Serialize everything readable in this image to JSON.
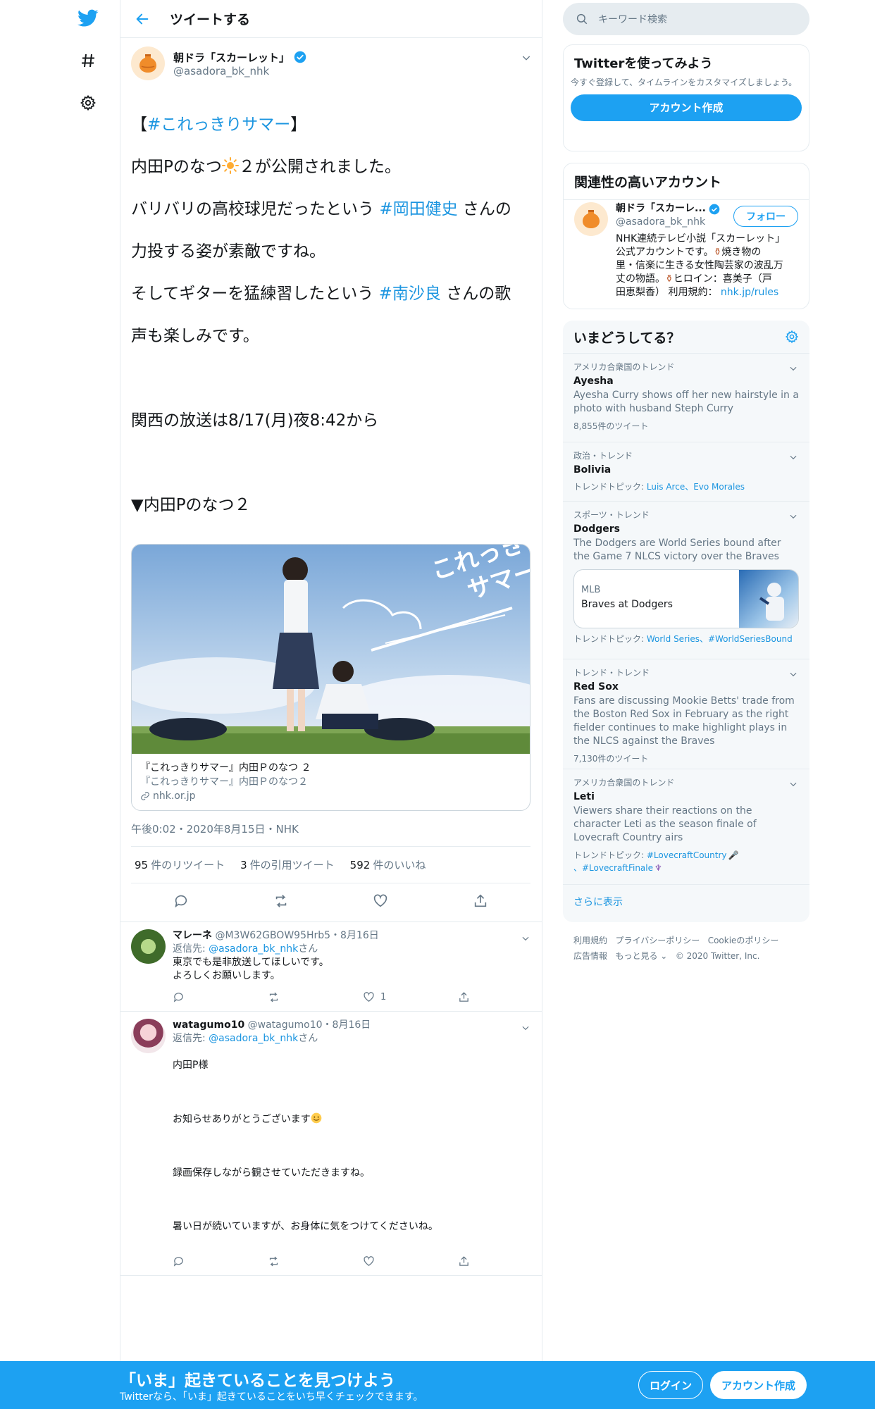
{
  "nav": {
    "icons": [
      "twitter-bird-icon",
      "hashtag-icon",
      "gear-icon"
    ]
  },
  "header": {
    "title": "ツイートする"
  },
  "tweet": {
    "author_name": "朝ドラ「スカーレット」",
    "author_handle": "@asadora_bk_nhk",
    "line1_pre": "【",
    "line1_tag": "#これっきりサマー",
    "line1_post": "】",
    "line2_pre": "内田Pのなつ",
    "line2_post": "２が公開されました。",
    "line3_pre": "バリバリの高校球児だったという ",
    "line3_tag": "#岡田健史",
    "line3_post": " さんの",
    "line4": "力投する姿が素敵ですね。",
    "line5_pre": "そしてギターを猛練習したという ",
    "line5_tag": "#南沙良",
    "line5_post": " さんの歌",
    "line6": "声も楽しみです。",
    "line7": "関西の放送は8/17(月)夜8:42から",
    "line8": "▼内田Pのなつ２",
    "card": {
      "image_text": "これっきり サマー",
      "title": "『これっきりサマー』内田Ｐのなつ ２",
      "description": "『これっきりサマー』内田Ｐのなつ２",
      "domain": "nhk.or.jp"
    },
    "meta": "午後0:02・2020年8月15日・NHK",
    "retweets_count": "95",
    "retweets_label": "件のリツイート",
    "quotes_count": "3",
    "quotes_label": "件の引用ツイート",
    "likes_count": "592",
    "likes_label": "件のいいね"
  },
  "replies": [
    {
      "name": "マレーネ",
      "handle_date": "@M3W62GBOW95Hrb5・8月16日",
      "to_prefix": "返信先: ",
      "to_handle": "@asadora_bk_nhk",
      "to_suffix": "さん",
      "text": "東京でも是非放送してほしいです。\nよろしくお願いします。",
      "likes": "1"
    },
    {
      "name": "watagumo10",
      "handle_date": "@watagumo10・8月16日",
      "to_prefix": "返信先: ",
      "to_handle": "@asadora_bk_nhk",
      "to_suffix": "さん",
      "text_1": "内田P様",
      "text_2": "お知らせありがとうございます",
      "text_3": "録画保存しながら観させていただきますね。",
      "text_4": "暑い日が続いていますが、お身体に気をつけてくださいね。",
      "likes": ""
    }
  ],
  "search": {
    "placeholder": "キーワード検索"
  },
  "signup_box": {
    "title": "Twitterを使ってみよう",
    "desc": "今すぐ登録して、タイムラインをカスタマイズしましょう。",
    "button": "アカウント作成"
  },
  "related": {
    "title": "関連性の高いアカウント",
    "name": "朝ドラ「スカーレ...",
    "handle": "@asadora_bk_nhk",
    "follow": "フォロー",
    "bio_1": "NHK連続テレビ小説「スカーレット」",
    "bio_2": "公式アカウントです。",
    "bio_3": "焼き物の",
    "bio_4": "里・信楽に生きる女性陶芸家の波乱万",
    "bio_5": "丈の物語。",
    "bio_6": "ヒロイン：喜美子（戸",
    "bio_7": "田恵梨香） 利用規約： ",
    "bio_link": "nhk.jp/rules"
  },
  "trends": {
    "title": "いまどうしてる？",
    "items": [
      {
        "ctx": "アメリカ合衆国のトレンド",
        "name": "Ayesha",
        "desc": "Ayesha Curry shows off her new hairstyle in a photo with husband Steph Curry",
        "sub": "8,855件のツイート"
      },
      {
        "ctx": "政治・トレンド",
        "name": "Bolivia",
        "sub_prefix": "トレンドトピック: ",
        "links": "Luis Arce、Evo Morales"
      },
      {
        "ctx": "スポーツ・トレンド",
        "name": "Dodgers",
        "desc": "The Dodgers are World Series bound after the Game 7 NLCS victory over the Braves",
        "card_cat": "MLB",
        "card_title": "Braves at Dodgers",
        "sub_prefix": "トレンドトピック: ",
        "links": "World Series、#WorldSeriesBound"
      },
      {
        "ctx": "トレンド・トレンド",
        "name": "Red Sox",
        "desc": "Fans are discussing Mookie Betts' trade from the Boston Red Sox in February as the right fielder continues to make highlight plays in the NLCS against the Braves",
        "sub": "7,130件のツイート"
      },
      {
        "ctx": "アメリカ合衆国のトレンド",
        "name": "Leti",
        "desc": "Viewers share their reactions on the character Leti as the season finale of Lovecraft Country airs",
        "sub_prefix": "トレンドトピック: ",
        "links": "#LovecraftCountry",
        "links2": "、#LovecraftFinale"
      }
    ],
    "more": "さらに表示"
  },
  "footer": {
    "l1": "利用規約",
    "l2": "プライバシーポリシー",
    "l3": "Cookieのポリシー",
    "l4": "広告情報",
    "l5": "もっと見る",
    "l6": "© 2020 Twitter, Inc."
  },
  "banner": {
    "headline": "「いま」起きていることを見つけよう",
    "sub": "Twitterなら、「いま」起きていることをいち早くチェックできます。",
    "login": "ログイン",
    "signup": "アカウント作成"
  },
  "colors": {
    "accent": "#1da1f2",
    "link": "#1b95e0",
    "muted": "#657786",
    "border": "#e6ecf0"
  }
}
